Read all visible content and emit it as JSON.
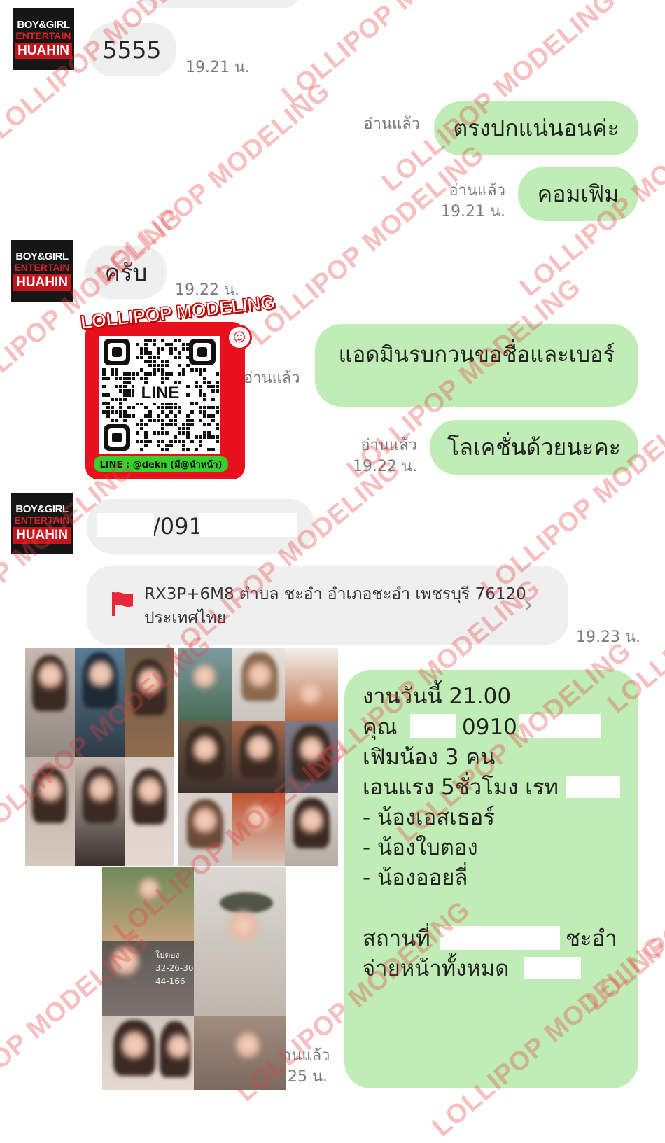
{
  "avatar": {
    "line1": "BOY&GIRL",
    "line2": "ENTERTAIN",
    "line3": "HUAHIN"
  },
  "messages": {
    "m1": {
      "text": "5555",
      "time": "19.21 น."
    },
    "m2": {
      "text": "ตรงปกแน่นอนค่ะ",
      "read": "อ่านแล้ว"
    },
    "m3": {
      "text": "คอมเฟิม",
      "read": "อ่านแล้ว",
      "time": "19.21 น."
    },
    "m4": {
      "text": "ครับ",
      "time": "19.22 น."
    },
    "qr": {
      "banner": "LOLLIPOP MODELING",
      "center": "LINE",
      "footer": "LINE :   @dekn (มี@นำหน้า)",
      "read": "อ่านแล้ว"
    },
    "m5": {
      "text": "แอดมินรบกวนขอชื่อและเบอร์"
    },
    "m6": {
      "text": "โลเคชั่นด้วยนะคะ",
      "read": "อ่านแล้ว",
      "time": "19.22 น."
    },
    "m7": {
      "text": "/091"
    },
    "location": {
      "line1": "RX3P+6M8 ตำบล ชะอำ อำเภอชะอำ เพชรบุรี 76120",
      "line2": "ประเทศไทย",
      "time": "19.23 น."
    },
    "photos": {
      "read": "านแล้ว",
      "time": ".25 น.",
      "overlay_text": "ใบตอง\n32-26-36\n44-166"
    },
    "details": {
      "lines": [
        "งานวันนี้ 21.00",
        "คุณ",
        "0910",
        "เฟิมน้อง 3 คน",
        "เอนแรง 5ชั่วโมง เรท",
        "- น้องเอสเธอร์",
        "- น้องใบตอง",
        "- น้องออยลี่",
        "สถานที่",
        "ชะอำ",
        "จ่ายหน้าทั้งหมด"
      ]
    }
  },
  "watermark": "LOLLIPOP MODELING",
  "colors": {
    "outgoing": "#bfedb5",
    "incoming": "#efefef",
    "watermark": "#e83c3c",
    "flag": "#e8283a",
    "qr_frame": "#e8101c",
    "qr_footer": "#37d12e"
  }
}
